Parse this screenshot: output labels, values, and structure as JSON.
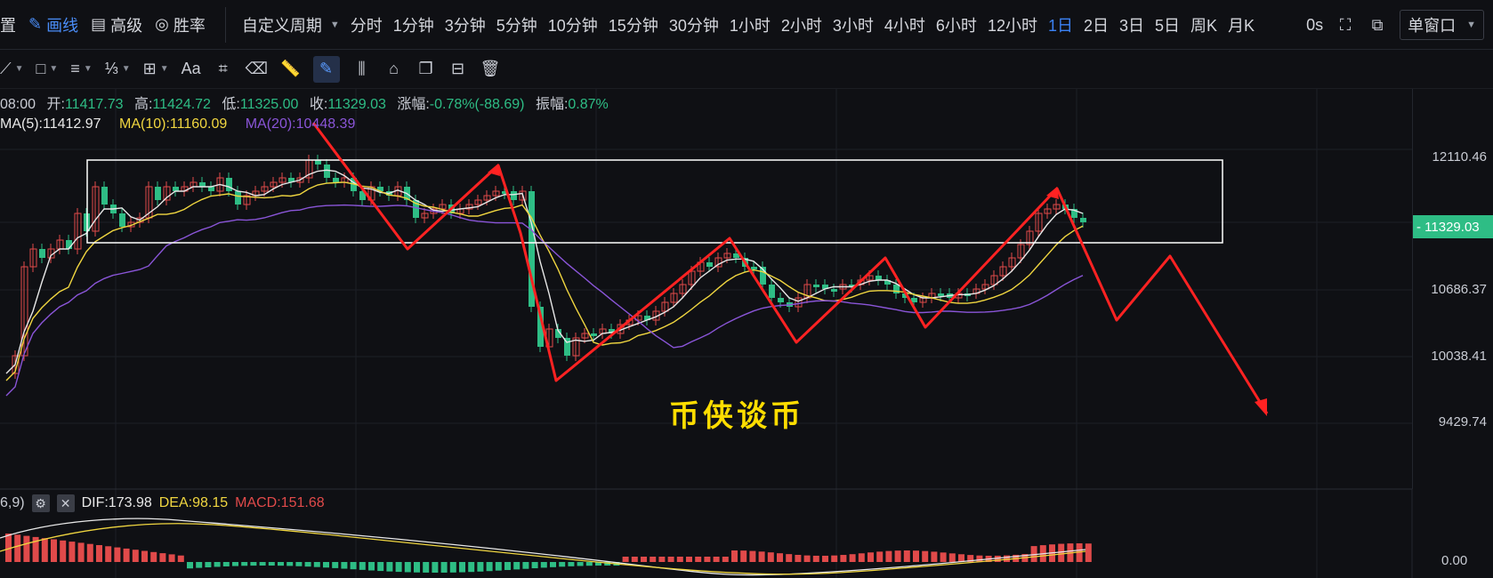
{
  "topbar": {
    "left_cut": "置",
    "draw_label": "画线",
    "advanced_label": "高级",
    "winrate_label": "胜率",
    "custom_period_label": "自定义周期",
    "periods": [
      "分时",
      "1分钟",
      "3分钟",
      "5分钟",
      "10分钟",
      "15分钟",
      "30分钟",
      "1小时",
      "2小时",
      "3小时",
      "4小时",
      "6小时",
      "12小时",
      "1日",
      "2日",
      "3日",
      "5日",
      "周K",
      "月K"
    ],
    "active_period": "1日",
    "countdown": "0s",
    "window_mode": "单窗口"
  },
  "drawing_tools": [
    {
      "name": "line-tool",
      "icon": "⟋",
      "has_caret": true
    },
    {
      "name": "rect-tool",
      "icon": "□",
      "has_caret": true
    },
    {
      "name": "parallel-tool",
      "icon": "≡",
      "has_caret": true
    },
    {
      "name": "fib-tool",
      "icon": "⅓",
      "has_caret": true
    },
    {
      "name": "measure-tool",
      "icon": "⊞",
      "has_caret": true
    },
    {
      "name": "text-tool",
      "icon": "Aa",
      "has_caret": false
    },
    {
      "name": "brush-tool",
      "icon": "⌗",
      "has_caret": false
    },
    {
      "name": "eraser-tool",
      "icon": "⌫",
      "has_caret": false
    },
    {
      "name": "ruler-tool",
      "icon": "📏",
      "has_caret": false
    },
    {
      "name": "pen-tool",
      "icon": "✎",
      "has_caret": false,
      "active": true
    },
    {
      "name": "candles-tool",
      "icon": "⫼",
      "has_caret": false
    },
    {
      "name": "lock-tool",
      "icon": "⌂",
      "has_caret": false
    },
    {
      "name": "copy-tool",
      "icon": "❐",
      "has_caret": false
    },
    {
      "name": "hide-tool",
      "icon": "⊟",
      "has_caret": false
    },
    {
      "name": "trash-tool",
      "icon": "🗑",
      "has_caret": false
    }
  ],
  "ohlc": {
    "time": "08:00",
    "open_label": "开:",
    "open": "11417.73",
    "high_label": "高:",
    "high": "11424.72",
    "low_label": "低:",
    "low": "11325.00",
    "close_label": "收:",
    "close": "11329.03",
    "change_label": "涨幅:",
    "change": "-0.78%(-88.69)",
    "amp_label": "振幅:",
    "amp": "0.87%"
  },
  "ma": {
    "ma5": "MA(5):11412.97",
    "ma10": "MA(10):11160.09",
    "ma20": "MA(20):10448.39"
  },
  "price_axis": [
    "12110.46",
    "10686.37",
    "10038.41",
    "9429.74"
  ],
  "current_price": "11329.03",
  "watermark": "币侠谈币",
  "macd": {
    "params": "6,9)",
    "dif": "DIF:173.98",
    "dea": "DEA:98.15",
    "macd": "MACD:151.68",
    "zero": "0.00"
  },
  "colors": {
    "up": "#e04a4a",
    "down": "#2ebd85",
    "ma5": "#e8e8e8",
    "ma10": "#f0d640",
    "ma20": "#8a55d8",
    "arrow": "#ff2222",
    "active": "#3b82f6"
  }
}
